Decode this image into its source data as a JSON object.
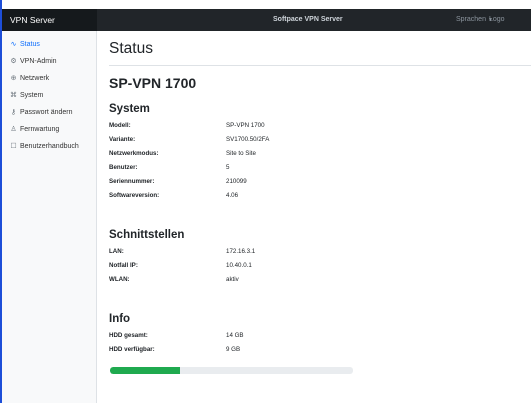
{
  "topbar": {
    "brand": "VPN Server",
    "title": "Softpace VPN Server",
    "language_label": "Sprachen",
    "logout_label": "Logo"
  },
  "sidebar": {
    "items": [
      {
        "label": "Status",
        "icon": "activity-icon",
        "glyph": "∿",
        "active": true
      },
      {
        "label": "VPN-Admin",
        "icon": "gear-icon",
        "glyph": "⚙",
        "active": false
      },
      {
        "label": "Netzwerk",
        "icon": "globe-icon",
        "glyph": "⊕",
        "active": false
      },
      {
        "label": "System",
        "icon": "command-icon",
        "glyph": "⌘",
        "active": false
      },
      {
        "label": "Passwort ändern",
        "icon": "key-icon",
        "glyph": "⚷",
        "active": false
      },
      {
        "label": "Fernwartung",
        "icon": "person-icon",
        "glyph": "♙",
        "active": false
      },
      {
        "label": "Benutzerhandbuch",
        "icon": "book-icon",
        "glyph": "☐",
        "active": false
      }
    ]
  },
  "main": {
    "page_title": "Status",
    "device_name": "SP-VPN 1700",
    "system": {
      "title": "System",
      "rows": [
        {
          "label": "Modell:",
          "value": "SP-VPN 1700"
        },
        {
          "label": "Variante:",
          "value": "SV1700.50/2FA"
        },
        {
          "label": "Netzwerkmodus:",
          "value": "Site to Site"
        },
        {
          "label": "Benutzer:",
          "value": "5"
        },
        {
          "label": "Seriennummer:",
          "value": "210099"
        },
        {
          "label": "Softwareversion:",
          "value": "4.06"
        }
      ]
    },
    "interfaces": {
      "title": "Schnittstellen",
      "rows": [
        {
          "label": "LAN:",
          "value": "172.16.3.1"
        },
        {
          "label": "Notfall IP:",
          "value": "10.40.0.1"
        },
        {
          "label": "WLAN:",
          "value": "aktiv"
        }
      ]
    },
    "info": {
      "title": "Info",
      "rows": [
        {
          "label": "HDD gesamt:",
          "value": "14 GB"
        },
        {
          "label": "HDD verfügbar:",
          "value": "9 GB"
        }
      ],
      "disk_used_fraction": 0.29
    }
  },
  "colors": {
    "accent": "#0d6efd",
    "topbar": "#212529",
    "progress_fill": "#1faa4f"
  }
}
